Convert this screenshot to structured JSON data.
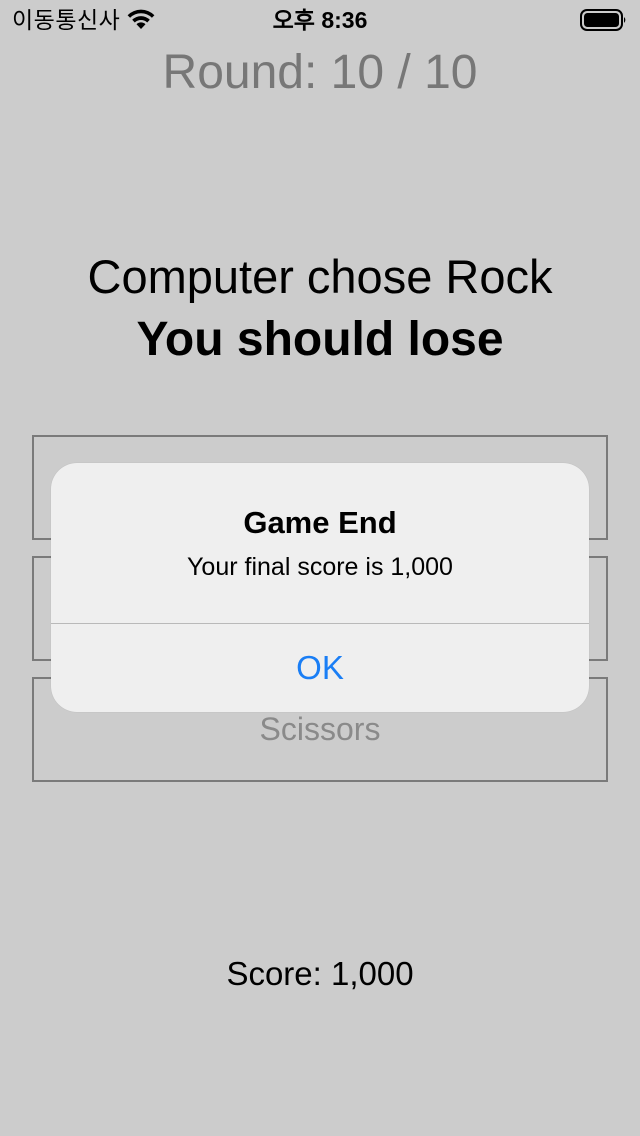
{
  "status_bar": {
    "carrier": "이동통신사",
    "time": "오후 8:36",
    "wifi_icon": "wifi-icon",
    "battery_icon": "battery-full-icon"
  },
  "game": {
    "round_text": "Round: 10 / 10",
    "prompt_line1": "Computer chose Rock",
    "prompt_line2": "You should lose",
    "choices": [
      {
        "label": ""
      },
      {
        "label": ""
      },
      {
        "label": "Scissors"
      }
    ],
    "score_text": "Score: 1,000"
  },
  "alert": {
    "title": "Game End",
    "message": "Your final score is 1,000",
    "ok_label": "OK",
    "ok_color": "#1a7ef5"
  },
  "colors": {
    "background": "#cccccc",
    "round_text": "#777777",
    "button_border": "#7a7a7a",
    "button_text": "#8a8a8a",
    "alert_background": "#efefef"
  }
}
